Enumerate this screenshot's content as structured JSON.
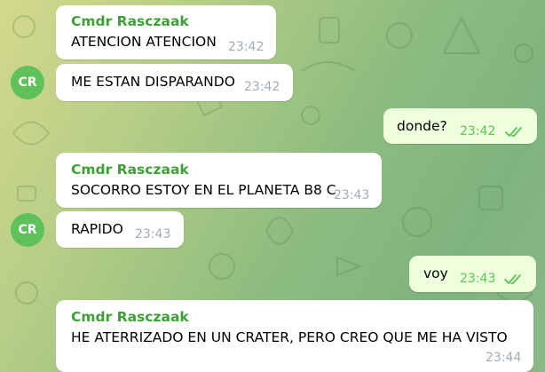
{
  "chat": {
    "colors": {
      "incoming": "#ffffff",
      "outgoing": "#eeffde",
      "sender": "#3da136",
      "avatar": "#5fc15a",
      "time_in": "#a0acb6",
      "time_out": "#5dc452"
    },
    "avatar_initials": "CR",
    "messages": [
      {
        "direction": "incoming",
        "sender": "Cmdr Rasczaak",
        "text": "ATENCION ATENCION",
        "time": "23:42"
      },
      {
        "direction": "incoming",
        "sender": "",
        "text": "ME ESTAN DISPARANDO",
        "time": "23:42"
      },
      {
        "direction": "outgoing",
        "text": "donde?",
        "time": "23:42",
        "status": "read-double-check-icon"
      },
      {
        "direction": "incoming",
        "sender": "Cmdr Rasczaak",
        "text": "SOCORRO ESTOY EN EL PLANETA B8 C",
        "time": "23:43"
      },
      {
        "direction": "incoming",
        "sender": "",
        "text": "RAPIDO",
        "time": "23:43"
      },
      {
        "direction": "outgoing",
        "text": "voy",
        "time": "23:43",
        "status": "read-double-check-icon"
      },
      {
        "direction": "incoming",
        "sender": "Cmdr Rasczaak",
        "text": "HE ATERRIZADO EN UN CRATER, PERO CREO QUE ME HA VISTO",
        "time": "23:44"
      }
    ]
  }
}
